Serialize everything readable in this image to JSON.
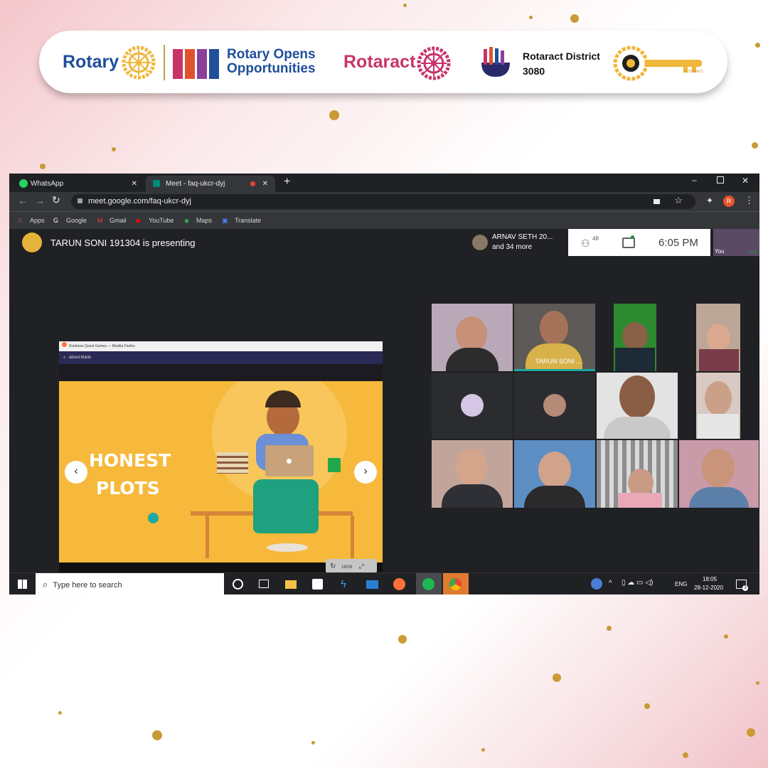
{
  "banner": {
    "rotary": "Rotary",
    "opens": "Rotary Opens Opportunities",
    "rotaract": "Rotaract",
    "district": "Rotaract District 3080",
    "key_text": "ROTARACT"
  },
  "browser": {
    "tabs": [
      {
        "label": "WhatsApp",
        "icon": "whatsapp-icon"
      },
      {
        "label": "Meet - faq-ukcr-dyj",
        "icon": "meet-icon"
      }
    ],
    "url": "meet.google.com/faq-ukcr-dyj",
    "bookmarks": [
      "Apps",
      "Google",
      "Gmail",
      "YouTube",
      "Maps",
      "Translate"
    ],
    "profile_initial": "R"
  },
  "meet": {
    "presenting": "TARUN SONI 191304 is presenting",
    "participants_line1": "ARNAV SETH 20...",
    "participants_line2": "and 34 more",
    "participant_count": "48",
    "time": "6:05 PM",
    "you_label": "You",
    "tarun_label": "TARUN SONI ..."
  },
  "presentation": {
    "window_title": "Kindness Quest Games — Mozilla Firefox",
    "address": "about:blank",
    "slide_title_line1": "HONEST",
    "slide_title_line2": "PLOTS",
    "slide_counter": "18/29"
  },
  "taskbar": {
    "search_placeholder": "Type here to search",
    "lang": "ENG",
    "time": "18:05",
    "date": "28-12-2020",
    "notifications": "3"
  },
  "colors": {
    "slide_bg": "#f6b93b",
    "meet_bg": "#202124",
    "rotary_blue": "#1f4e9a",
    "rotaract_pink": "#c8336a"
  }
}
